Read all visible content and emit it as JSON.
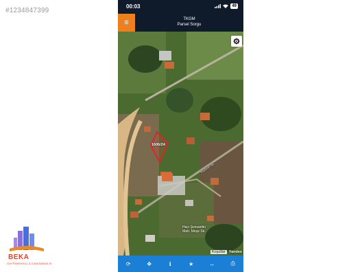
{
  "listing_id": "#1234847399",
  "status_bar": {
    "time": "00:03",
    "battery": "49"
  },
  "app": {
    "title": "TKGM",
    "subtitle": "Parsel Sorgu",
    "accent_color": "#ef7f1a",
    "bar_color": "#1b7fd6"
  },
  "map": {
    "parcel_label": "1606/24",
    "road_label": "Yeşilyurt Sk.",
    "place_label_line1": "Hacı Şemsettin",
    "place_label_line2": "Mah. Meşe Sk.",
    "attribution_link": "Koşullar",
    "attribution_brand": "Yandex"
  },
  "bottom_bar": {
    "items": [
      {
        "icon": "refresh-icon",
        "glyph": "⟳"
      },
      {
        "icon": "locate-icon",
        "glyph": "✥"
      },
      {
        "icon": "info-icon",
        "glyph": "ℹ"
      },
      {
        "icon": "star-icon",
        "glyph": "★"
      },
      {
        "icon": "measure-icon",
        "glyph": "↔"
      },
      {
        "icon": "print-icon",
        "glyph": "⎙"
      }
    ]
  },
  "logo": {
    "brand": "BEKA",
    "tagline": "GAYRİMENKUL & DANIŞMANLIK"
  }
}
